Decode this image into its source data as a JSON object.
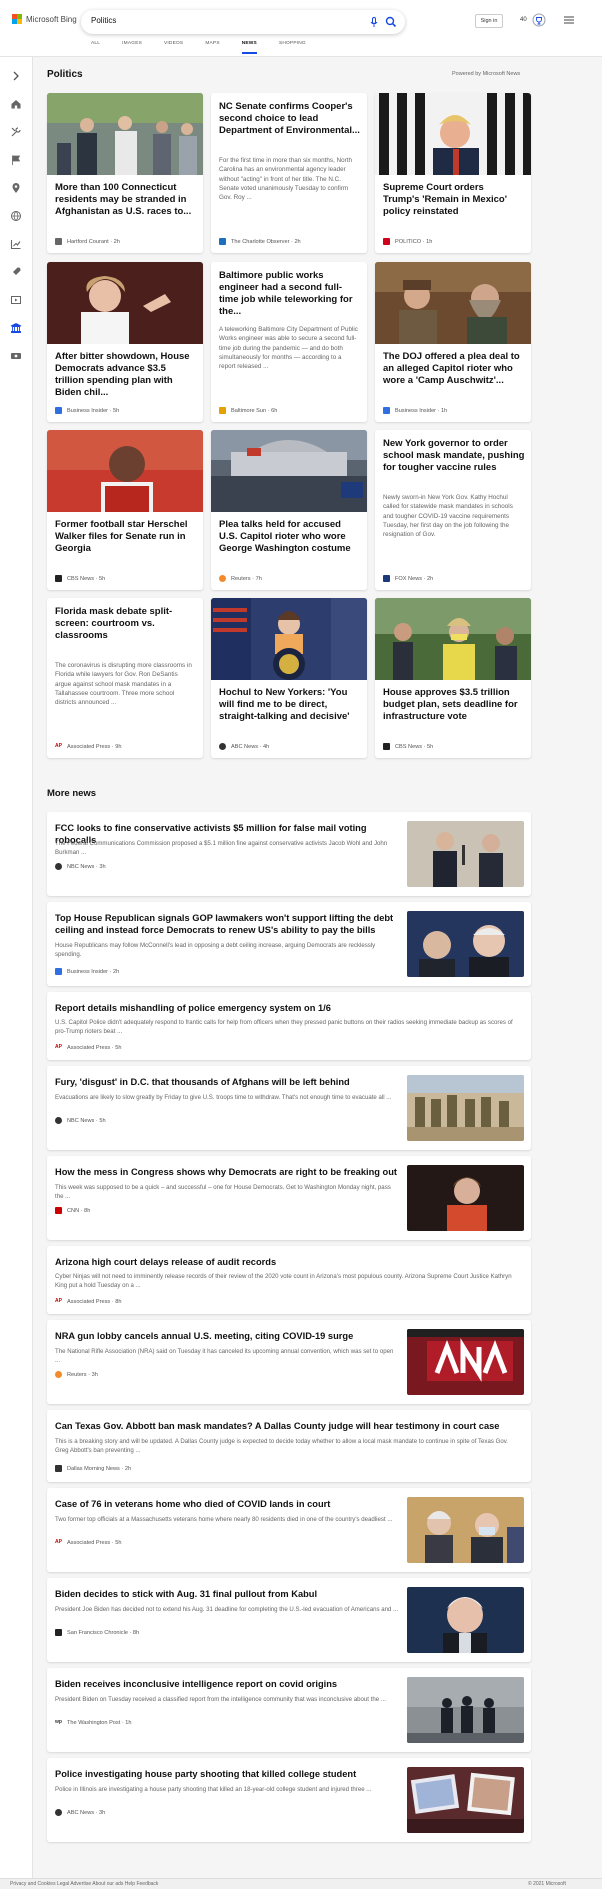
{
  "header": {
    "logo_text": "Microsoft Bing",
    "search_value": "Politics",
    "signin_label": "Sign in",
    "points": "40"
  },
  "tabs": [
    "ALL",
    "IMAGES",
    "VIDEOS",
    "MAPS",
    "NEWS",
    "SHOPPING"
  ],
  "active_tab": "NEWS",
  "section": {
    "title": "Politics",
    "powered_by": "Powered by Microsoft News"
  },
  "top_cards": [
    {
      "title": "More than 100 Connecticut residents may be stranded in Afghanistan as U.S. races to...",
      "snippet": "",
      "source": "Hartford Courant",
      "time": "2h",
      "source_color": "#555555",
      "image": "crowd-at-press-conference"
    },
    {
      "title": "NC Senate confirms Cooper's second choice to lead Department of Environmental...",
      "snippet": "For the first time in more than six months, North Carolina has an environmental agency leader without \"acting\" in front of her title. The N.C. Senate voted unanimously Tuesday to confirm Gov. Roy ...",
      "source": "The Charlotte Observer",
      "time": "2h",
      "source_color": "#1f6fbf",
      "image": ""
    },
    {
      "title": "Supreme Court orders Trump's 'Remain in Mexico' policy reinstated",
      "snippet": "",
      "source": "POLITICO",
      "time": "1h",
      "source_color": "#d0021b",
      "image": "trump-striped-backdrop"
    },
    {
      "title": "After bitter showdown, House Democrats advance $3.5 trillion spending plan with Biden chil...",
      "snippet": "",
      "source": "Business Insider",
      "time": "5h",
      "source_color": "#2f6fe0",
      "image": "pelosi-speaking"
    },
    {
      "title": "Baltimore public works engineer had a second full-time job while teleworking for the...",
      "snippet": "A teleworking Baltimore City Department of Public Works engineer was able to secure a second full-time job during the pandemic — and do both simultaneously for months — according to a report released ...",
      "source": "Baltimore Sun",
      "time": "6h",
      "source_color": "#e5a100",
      "image": ""
    },
    {
      "title": "The DOJ offered a plea deal to an alleged Capitol rioter who wore a 'Camp Auschwitz'...",
      "snippet": "",
      "source": "Business Insider",
      "time": "1h",
      "source_color": "#2f6fe0",
      "image": "capitol-rioters"
    },
    {
      "title": "Former football star Herschel Walker files for Senate run in Georgia",
      "snippet": "",
      "source": "CBS News",
      "time": "5h",
      "source_color": "#222222",
      "image": "herschel-walker"
    },
    {
      "title": "Plea talks held for accused U.S. Capitol rioter who wore George Washington costume",
      "snippet": "",
      "source": "Reuters",
      "time": "7h",
      "source_color": "#f28c28",
      "image": "capitol-crowd"
    },
    {
      "title": "New York governor to order school mask mandate, pushing for tougher vaccine rules",
      "snippet": "Newly sworn-in New York Gov. Kathy Hochul called for statewide mask mandates in schools and tougher COVID-19 vaccine requirements Tuesday, her first day on the job following the resignation of Gov.",
      "source": "FOX News",
      "time": "2h",
      "source_color": "#1b3a7a",
      "image": ""
    },
    {
      "title": "Florida mask debate split-screen: courtroom vs. classrooms",
      "snippet": "The coronavirus is disrupting more classrooms in Florida while lawyers for Gov. Ron DeSantis argue against school mask mandates in a Tallahassee courtroom. Three more school districts announced ...",
      "source": "Associated Press",
      "time": "9h",
      "source_color": "#cc0000",
      "image": ""
    },
    {
      "title": "Hochul to New Yorkers: 'You will find me to be direct, straight-talking and decisive'",
      "snippet": "",
      "source": "ABC News",
      "time": "4h",
      "source_color": "#333333",
      "image": "hochul-podium"
    },
    {
      "title": "House approves $3.5 trillion budget plan, sets deadline for infrastructure vote",
      "snippet": "",
      "source": "CBS News",
      "time": "5h",
      "source_color": "#222222",
      "image": "pelosi-mask"
    }
  ],
  "more_news": {
    "title": "More news",
    "items": [
      {
        "title": "FCC looks to fine conservative activists $5 million for false mail voting robocalls",
        "snippet": "The Federal Communications Commission proposed a $5.1 million fine against conservative activists Jacob Wohl and John Burkman ...",
        "source": "NBC News",
        "time": "3h",
        "source_color": "#333333",
        "image": "two-men-microphones"
      },
      {
        "title": "Top House Republican signals GOP lawmakers won't support lifting the debt ceiling and instead force Democrats to renew US's ability to pay the bills",
        "snippet": "House Republicans may follow McConnell's lead in opposing a debt ceiling increase, arguing Democrats are recklessly spending.",
        "source": "Business Insider",
        "time": "2h",
        "source_color": "#2f6fe0",
        "image": "lawmakers-talking"
      },
      {
        "title": "Report details mishandling of police emergency system on 1/6",
        "snippet": "U.S. Capitol Police didn't adequately respond to frantic calls for help from officers when they pressed panic buttons on their radios seeking immediate backup as scores of pro-Trump rioters beat ...",
        "source": "Associated Press",
        "time": "5h",
        "source_color": "#cc0000",
        "image": ""
      },
      {
        "title": "Fury, 'disgust' in D.C. that thousands of Afghans will be left behind",
        "snippet": "Evacuations are likely to slow greatly by Friday to give U.S. troops time to withdraw. That's not enough time to evacuate all ...",
        "source": "NBC News",
        "time": "5h",
        "source_color": "#333333",
        "image": "troops-airport"
      },
      {
        "title": "How the mess in Congress shows why Democrats are right to be freaking out",
        "snippet": "This week was supposed to be a quick – and successful – one for House Democrats. Get to Washington Monday night, pass the ...",
        "source": "CNN",
        "time": "8h",
        "source_color": "#cc0000",
        "image": "pelosi-dark"
      },
      {
        "title": "Arizona high court delays release of audit records",
        "snippet": "Cyber Ninjas will not need to imminently release records of their review of the 2020 vote count in Arizona's most populous county. Arizona Supreme Court Justice Kathryn King put a hold Tuesday on a ...",
        "source": "Associated Press",
        "time": "8h",
        "source_color": "#cc0000",
        "image": ""
      },
      {
        "title": "NRA gun lobby cancels annual U.S. meeting, citing COVID-19 surge",
        "snippet": "The National Rifle Association (NRA) said on Tuesday it has canceled its upcoming annual convention, which was set to open ...",
        "source": "Reuters",
        "time": "3h",
        "source_color": "#f28c28",
        "image": "nra-sign"
      },
      {
        "title": "Can Texas Gov. Abbott ban mask mandates? A Dallas County judge will hear testimony in court case",
        "snippet": "This is a breaking story and will be updated. A Dallas County judge is expected to decide today whether to allow a local mask mandate to continue in spite of Texas Gov. Greg Abbott's ban preventing ...",
        "source": "Dallas Morning News",
        "time": "2h",
        "source_color": "#333333",
        "image": ""
      },
      {
        "title": "Case of 76 in veterans home who died of COVID lands in court",
        "snippet": "Two former top officials at a Massachusetts veterans home where nearly 80 residents died in one of the country's deadliest ...",
        "source": "Associated Press",
        "time": "5h",
        "source_color": "#cc0000",
        "image": "officials-in-masks"
      },
      {
        "title": "Biden decides to stick with Aug. 31 final pullout from Kabul",
        "snippet": "President Joe Biden has decided not to extend his Aug. 31 deadline for completing the U.S.-led evacuation of Americans and ...",
        "source": "San Francisco Chronicle",
        "time": "8h",
        "source_color": "#222222",
        "image": "official-portrait"
      },
      {
        "title": "Biden receives inconclusive intelligence report on covid origins",
        "snippet": "President Biden on Tuesday received a classified report from the intelligence community that was inconclusive about the ...",
        "source": "The Washington Post",
        "time": "1h",
        "source_color": "#333333",
        "image": "guards-in-fog"
      },
      {
        "title": "Police investigating house party shooting that killed college student",
        "snippet": "Police in Illinois are investigating a house party shooting that killed an 18-year-old college student and injured three ...",
        "source": "ABC News",
        "time": "3h",
        "source_color": "#333333",
        "image": "memorial-photos"
      }
    ]
  },
  "footer_text": "Privacy and Cookies   Legal   Advertise   About our ads   Help   Feedback",
  "footer_right": "© 2021 Microsoft"
}
